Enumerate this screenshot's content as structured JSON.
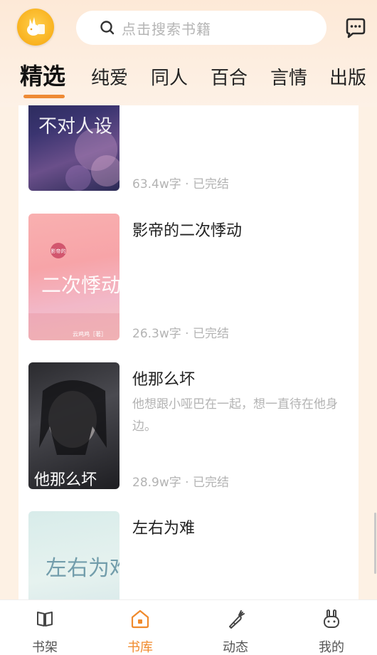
{
  "header": {
    "search_placeholder": "点击搜索书籍"
  },
  "tabs": [
    {
      "label": "精选",
      "active": true
    },
    {
      "label": "纯爱",
      "active": false
    },
    {
      "label": "同人",
      "active": false
    },
    {
      "label": "百合",
      "active": false
    },
    {
      "label": "言情",
      "active": false
    },
    {
      "label": "出版",
      "active": false
    }
  ],
  "books": [
    {
      "title": "",
      "desc": "",
      "meta": "63.4w字 · 已完结",
      "cover_text": "不对人设"
    },
    {
      "title": "影帝的二次悸动",
      "desc": "",
      "meta": "26.3w字 · 已完结",
      "cover_text": "二次悸动",
      "cover_small": "影帝的",
      "cover_author": "云鸡鸡［著］"
    },
    {
      "title": "他那么坏",
      "desc": "他想跟小哑巴在一起，想一直待在他身边。",
      "meta": "28.9w字 · 已完结",
      "cover_text": "他那么坏"
    },
    {
      "title": "左右为难",
      "desc": "",
      "meta": "",
      "cover_text": "左右为难"
    }
  ],
  "bottom_nav": [
    {
      "label": "书架",
      "icon": "book-icon",
      "active": false
    },
    {
      "label": "书库",
      "icon": "library-home-icon",
      "active": true
    },
    {
      "label": "动态",
      "icon": "carrot-icon",
      "active": false
    },
    {
      "label": "我的",
      "icon": "bunny-face-icon",
      "active": false
    }
  ],
  "colors": {
    "accent": "#f08a2c",
    "tab_underline": "#ee8a35",
    "header_bg": "#fde9d7",
    "muted_text": "#b3b3b3"
  }
}
